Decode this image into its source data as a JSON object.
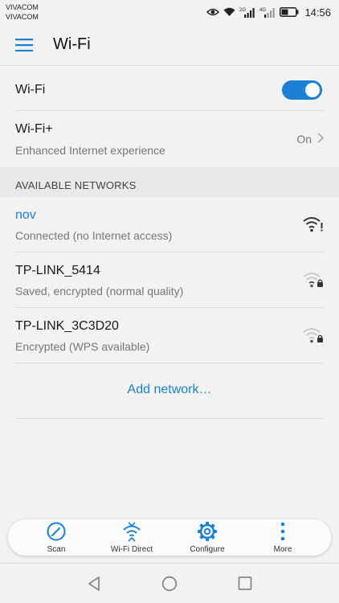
{
  "status_bar": {
    "carrier_1": "VIVACOM",
    "carrier_2": "VIVACOM",
    "network_type_1": "2G",
    "network_type_2": "4G",
    "time": "14:56",
    "icons": [
      "eye-comfort-icon",
      "wifi-icon",
      "signal-icon",
      "signal-icon",
      "battery-icon"
    ]
  },
  "app_bar": {
    "title": "Wi-Fi",
    "menu_icon": "hamburger-menu-icon"
  },
  "settings": {
    "wifi": {
      "label": "Wi-Fi",
      "enabled": true
    },
    "wifi_plus": {
      "label": "Wi-Fi+",
      "description": "Enhanced Internet experience",
      "status": "On"
    }
  },
  "available_networks": {
    "header": "AVAILABLE NETWORKS",
    "items": [
      {
        "name": "nov",
        "status": "Connected (no Internet access)",
        "connected": true,
        "icon": "wifi-warning-icon"
      },
      {
        "name": "TP-LINK_5414",
        "status": "Saved, encrypted (normal quality)",
        "connected": false,
        "icon": "wifi-lock-icon"
      },
      {
        "name": "TP-LINK_3C3D20",
        "status": "Encrypted (WPS available)",
        "connected": false,
        "icon": "wifi-lock-icon"
      }
    ],
    "add_network": "Add network…"
  },
  "action_bar": {
    "items": [
      {
        "label": "Scan",
        "icon": "scan-icon"
      },
      {
        "label": "Wi-Fi Direct",
        "icon": "wifi-direct-icon"
      },
      {
        "label": "Configure",
        "icon": "gear-icon"
      },
      {
        "label": "More",
        "icon": "more-vertical-icon"
      }
    ]
  },
  "nav_bar": {
    "icons": [
      "back-icon",
      "home-icon",
      "recents-icon"
    ]
  },
  "colors": {
    "accent": "#1a80d6",
    "background": "#f2f2f2",
    "section_header_bg": "#e9e9e9",
    "secondary_text": "#777777"
  }
}
